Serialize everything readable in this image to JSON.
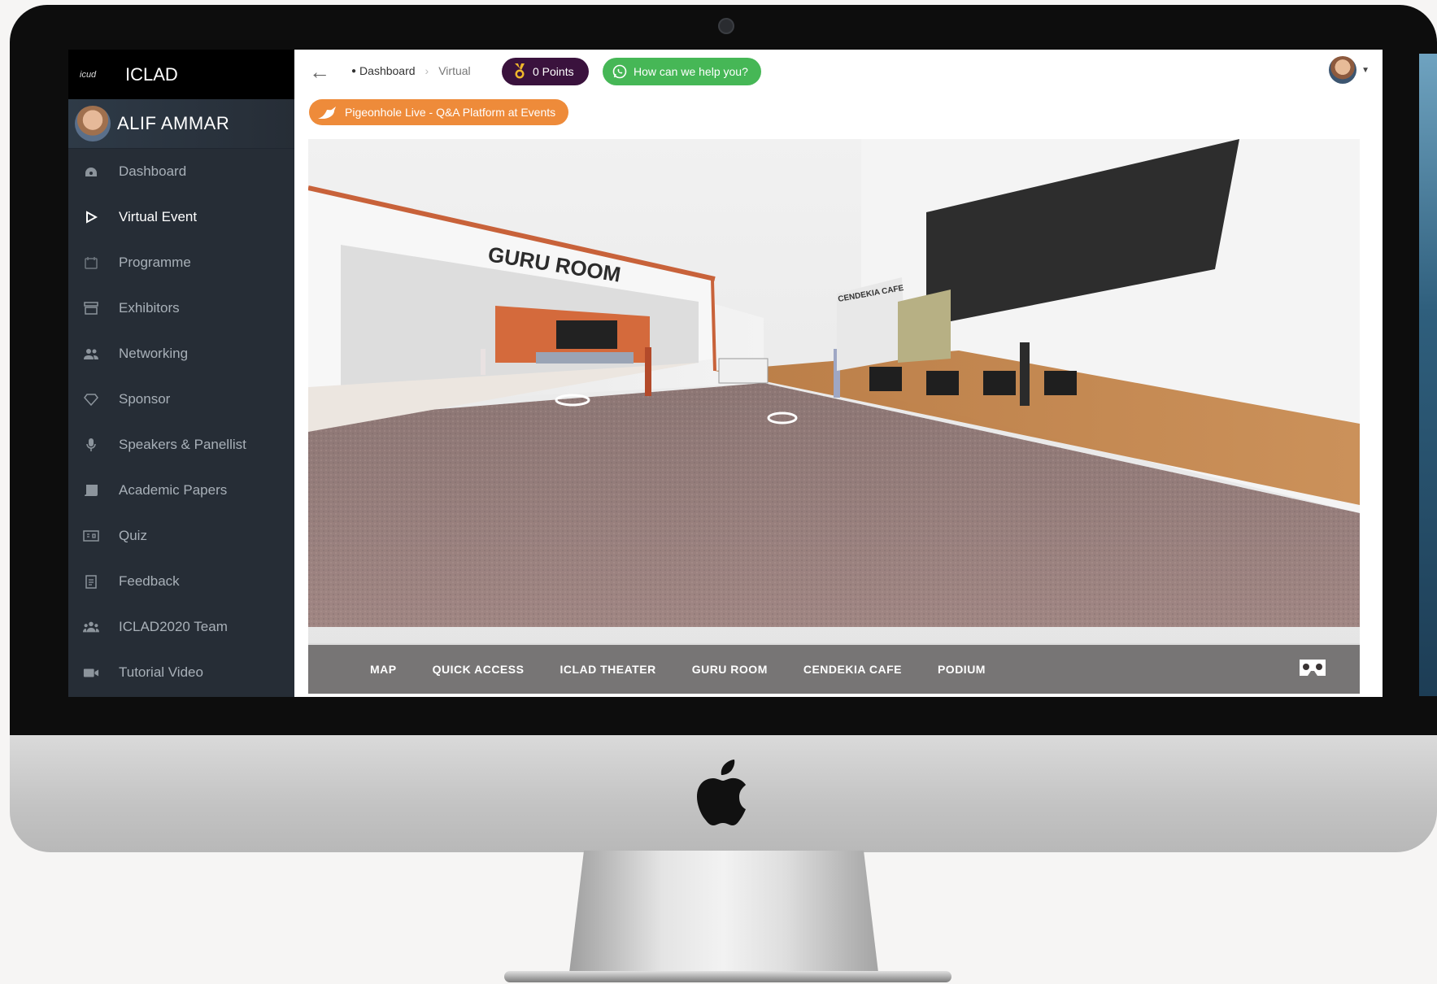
{
  "sidebar": {
    "logo_text": "icud",
    "title": "ICLAD",
    "user_name": "ALIF AMMAR",
    "items": [
      {
        "label": "Dashboard",
        "icon": "dashboard-icon"
      },
      {
        "label": "Virtual Event",
        "icon": "play-icon",
        "active": true
      },
      {
        "label": "Programme",
        "icon": "calendar-icon"
      },
      {
        "label": "Exhibitors",
        "icon": "booth-icon"
      },
      {
        "label": "Networking",
        "icon": "people-icon"
      },
      {
        "label": "Sponsor",
        "icon": "diamond-icon"
      },
      {
        "label": "Speakers & Panellist",
        "icon": "microphone-icon"
      },
      {
        "label": "Academic Papers",
        "icon": "scroll-icon"
      },
      {
        "label": "Quiz",
        "icon": "quiz-icon"
      },
      {
        "label": "Feedback",
        "icon": "clipboard-icon"
      },
      {
        "label": "ICLAD2020 Team",
        "icon": "team-icon"
      },
      {
        "label": "Tutorial Video",
        "icon": "video-icon"
      }
    ]
  },
  "topbar": {
    "back_icon": "←",
    "breadcrumb": {
      "home": "Dashboard",
      "current": "Virtual"
    },
    "points_label": "0 Points",
    "help_label": "How can we help you?"
  },
  "banner": {
    "label": "Pigeonhole Live - Q&A Platform at Events"
  },
  "scene": {
    "room_sign": "GURU ROOM",
    "cafe_sign": "CENDEKIA CAFE"
  },
  "tour_nav": {
    "links": [
      "MAP",
      "QUICK ACCESS",
      "ICLAD THEATER",
      "GURU ROOM",
      "CENDEKIA CAFE",
      "PODIUM"
    ]
  },
  "colors": {
    "sidebar_bg": "#262d36",
    "points_bg": "#3a123d",
    "help_bg": "#46b756",
    "banner_bg": "#ee8b3a"
  }
}
